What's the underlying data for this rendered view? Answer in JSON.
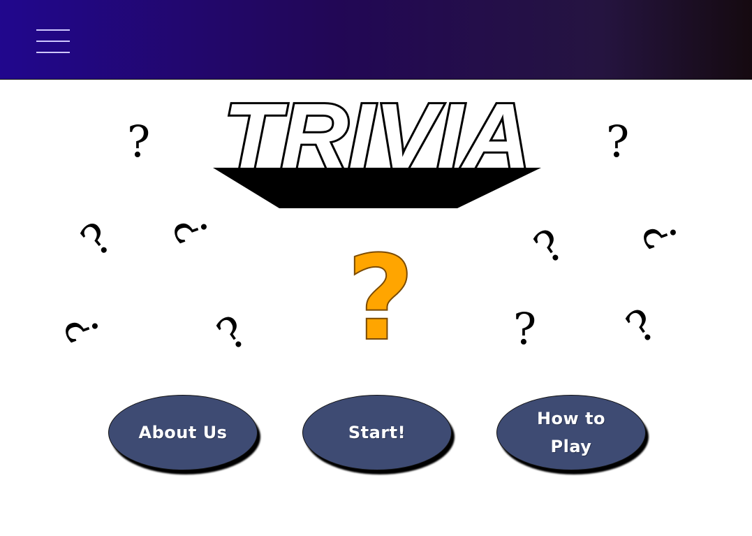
{
  "header": {
    "menu_icon": "hamburger-menu-icon"
  },
  "title": {
    "text": "TRIVIA"
  },
  "decor": {
    "glyph": "?",
    "center_color": "#ffa500"
  },
  "buttons": {
    "about": "About Us",
    "start": "Start!",
    "how_to_play": "How to Play"
  },
  "colors": {
    "header_start": "#21078d",
    "header_end": "#150a10",
    "button": "#3e4b73"
  }
}
